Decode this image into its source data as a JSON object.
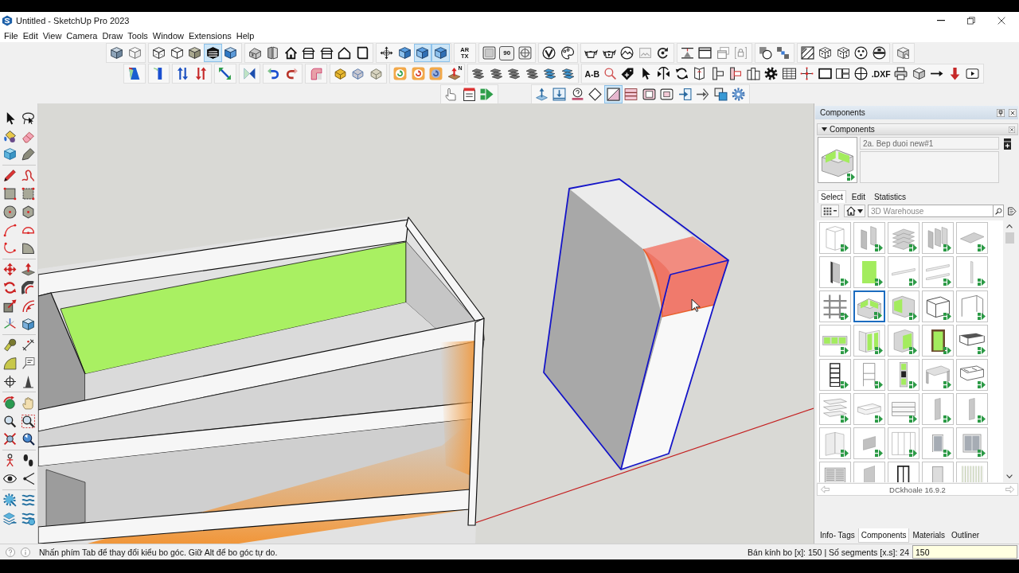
{
  "window": {
    "title": "Untitled - SketchUp Pro 2023"
  },
  "menu": [
    "File",
    "Edit",
    "View",
    "Camera",
    "Draw",
    "Tools",
    "Window",
    "Extensions",
    "Help"
  ],
  "toolbars": [
    {
      "groups": [
        {
          "buttons": [
            {
              "kind": "cube-xray",
              "selected": false
            },
            {
              "kind": "cube-edges",
              "selected": false
            }
          ]
        },
        {
          "buttons": [
            {
              "kind": "cube-wireframe",
              "selected": false
            },
            {
              "kind": "cube-hidden-line",
              "selected": false
            },
            {
              "kind": "cube-shaded",
              "selected": false
            },
            {
              "kind": "cube-striped",
              "selected": true
            },
            {
              "kind": "cube-textured",
              "selected": false
            }
          ]
        },
        {
          "buttons": [
            {
              "kind": "house-iso",
              "selected": false
            },
            {
              "kind": "door-pair",
              "selected": false
            },
            {
              "kind": "house",
              "selected": false
            },
            {
              "kind": "house-roof",
              "selected": false
            },
            {
              "kind": "house-roof",
              "selected": false
            },
            {
              "kind": "house-outline",
              "selected": false
            },
            {
              "kind": "page",
              "selected": false
            }
          ]
        },
        {
          "buttons": [
            {
              "kind": "axes-arrows",
              "selected": false
            },
            {
              "kind": "cube-section",
              "selected": false
            },
            {
              "kind": "cube-section",
              "selected": true
            },
            {
              "kind": "cube-section",
              "selected": true
            }
          ]
        },
        {
          "buttons": [
            {
              "kind": "text-stacked",
              "label": "AR TX",
              "selected": false
            }
          ]
        },
        {
          "buttons": [
            {
              "kind": "frame",
              "selected": false
            },
            {
              "kind": "text-framed",
              "label": "90",
              "selected": false
            },
            {
              "kind": "target",
              "selected": false
            }
          ]
        },
        {
          "buttons": [
            {
              "kind": "v-circle",
              "selected": false
            },
            {
              "kind": "palette",
              "selected": false
            }
          ]
        },
        {
          "buttons": [
            {
              "kind": "teapot",
              "selected": false
            },
            {
              "kind": "teapot-play",
              "selected": false
            },
            {
              "kind": "mountain-circle",
              "selected": false
            },
            {
              "kind": "picture-frame",
              "selected": false
            },
            {
              "kind": "refresh-partial",
              "selected": false
            }
          ]
        },
        {
          "buttons": [
            {
              "kind": "lamp-frame",
              "selected": false
            },
            {
              "kind": "window-frame",
              "selected": false
            },
            {
              "kind": "windows-stack",
              "selected": false
            },
            {
              "kind": "lock-frame",
              "selected": false
            }
          ]
        },
        {
          "buttons": [
            {
              "kind": "overlap-circles",
              "selected": false
            },
            {
              "kind": "dots-scatter",
              "selected": false
            }
          ]
        },
        {
          "buttons": [
            {
              "kind": "map-tile",
              "selected": false
            },
            {
              "kind": "dice",
              "selected": false
            },
            {
              "kind": "dice",
              "selected": false
            },
            {
              "kind": "dots-ball",
              "selected": false
            },
            {
              "kind": "split-ball",
              "selected": false
            }
          ]
        },
        {
          "buttons": [
            {
              "kind": "cube-hand",
              "selected": false
            }
          ]
        }
      ]
    },
    {
      "groups": [
        {
          "buttons": [
            {
              "kind": "paint-square",
              "selected": false
            }
          ]
        },
        {
          "buttons": [
            {
              "kind": "bar-vertical",
              "selected": false
            }
          ]
        },
        {
          "buttons": [
            {
              "kind": "arrows-up-down",
              "selected": false
            },
            {
              "kind": "arrows-down-up",
              "selected": false
            }
          ]
        },
        {
          "buttons": [
            {
              "kind": "diagonal-arrow",
              "selected": false
            }
          ]
        },
        {
          "buttons": [
            {
              "kind": "hourglass",
              "selected": false
            }
          ]
        },
        {
          "buttons": [
            {
              "kind": "curved-arrow",
              "selected": false
            },
            {
              "kind": "curved-arrow-back",
              "selected": false
            }
          ]
        },
        {
          "buttons": [
            {
              "kind": "pipe-elbow",
              "selected": false
            }
          ]
        },
        {
          "buttons": [
            {
              "kind": "round-block",
              "selected": false
            },
            {
              "kind": "round-block-plain",
              "selected": false
            },
            {
              "kind": "round-block-soft",
              "selected": false
            }
          ]
        },
        {
          "buttons": [
            {
              "kind": "ring-arrow",
              "selected": false
            },
            {
              "kind": "ring-arrow-back",
              "selected": false
            },
            {
              "kind": "ring-arrow-dim",
              "selected": false
            },
            {
              "kind": "box-arrow-up",
              "label": "N",
              "selected": false
            }
          ]
        },
        {
          "buttons": [
            {
              "kind": "tile-stack",
              "selected": false
            },
            {
              "kind": "tile-stack",
              "selected": false
            },
            {
              "kind": "tile-stack",
              "selected": false
            },
            {
              "kind": "tile-stack",
              "selected": false
            },
            {
              "kind": "tile-stack-tinted",
              "selected": false
            },
            {
              "kind": "tile-stack-tinted",
              "selected": false
            }
          ]
        },
        {
          "buttons": [
            {
              "kind": "text",
              "label": "A-B",
              "selected": false
            },
            {
              "kind": "magnifier",
              "selected": false
            },
            {
              "kind": "tag-plus",
              "selected": false
            },
            {
              "kind": "pointer",
              "selected": false
            },
            {
              "kind": "flip-arrows",
              "selected": false
            },
            {
              "kind": "refresh",
              "selected": false
            },
            {
              "kind": "book-open",
              "selected": false
            },
            {
              "kind": "align-block",
              "selected": false
            },
            {
              "kind": "align-block-marked",
              "selected": false
            },
            {
              "kind": "columns",
              "selected": false
            },
            {
              "kind": "gear",
              "selected": false
            },
            {
              "kind": "table",
              "selected": false
            },
            {
              "kind": "crosshair-dots",
              "selected": false
            },
            {
              "kind": "rectangle",
              "selected": false
            },
            {
              "kind": "panels-grid",
              "selected": false
            },
            {
              "kind": "circle-cross",
              "selected": false
            },
            {
              "kind": "text",
              "label": ".DXF",
              "selected": false
            },
            {
              "kind": "printer",
              "selected": false
            },
            {
              "kind": "box-open",
              "selected": false
            },
            {
              "kind": "arrow-right",
              "selected": false
            },
            {
              "kind": "arrow-down",
              "selected": false
            },
            {
              "kind": "play-square",
              "selected": false
            }
          ]
        }
      ]
    },
    {
      "groups": [
        {
          "buttons": [
            {
              "kind": "hand-pointer",
              "selected": false
            },
            {
              "kind": "clipboard",
              "selected": false
            },
            {
              "kind": "play-blocks",
              "selected": false
            }
          ]
        },
        {
          "buttons": [
            {
              "kind": "pin-up",
              "selected": false
            },
            {
              "kind": "download-tray",
              "selected": false
            },
            {
              "kind": "question-stamp",
              "selected": false
            },
            {
              "kind": "diamond-plus",
              "selected": false
            },
            {
              "kind": "square-diagonal",
              "selected": true
            },
            {
              "kind": "stripes-box",
              "selected": false
            },
            {
              "kind": "frame-rounded",
              "selected": false
            },
            {
              "kind": "frame-rounded-small",
              "selected": false
            },
            {
              "kind": "arrow-into-box",
              "selected": false
            },
            {
              "kind": "arrow-into-bracket",
              "selected": false
            },
            {
              "kind": "squares-overlap",
              "selected": false
            },
            {
              "kind": "gear-badge",
              "selected": false
            }
          ]
        }
      ]
    }
  ],
  "left_toolbar": {
    "groups": [
      {
        "buttons": [
          {
            "kind": "select-arrow",
            "selected": false
          },
          {
            "kind": "lasso",
            "selected": false
          },
          {
            "kind": "paint-bucket",
            "selected": false
          },
          {
            "kind": "eraser",
            "selected": false
          },
          {
            "kind": "cube-tinted",
            "selected": false
          },
          {
            "kind": "pen-tag",
            "selected": false
          }
        ]
      },
      {
        "buttons": [
          {
            "kind": "pencil",
            "selected": false
          },
          {
            "kind": "freehand",
            "selected": false
          },
          {
            "kind": "rectangle-tool",
            "selected": false
          },
          {
            "kind": "rectangle-rotated",
            "selected": false
          },
          {
            "kind": "circle-tool",
            "selected": false
          },
          {
            "kind": "polygon-tool",
            "selected": false
          },
          {
            "kind": "arc",
            "selected": false
          },
          {
            "kind": "arc-center",
            "selected": false
          },
          {
            "kind": "arc-three",
            "selected": false
          },
          {
            "kind": "pie",
            "selected": false
          }
        ]
      },
      {
        "buttons": [
          {
            "kind": "move-arrows",
            "selected": false
          },
          {
            "kind": "push-pull",
            "selected": false
          },
          {
            "kind": "rotate-arrows",
            "selected": false
          },
          {
            "kind": "follow-me",
            "selected": false
          },
          {
            "kind": "scale-box",
            "selected": false
          },
          {
            "kind": "offset",
            "selected": false
          },
          {
            "kind": "axes",
            "selected": false
          },
          {
            "kind": "texture-cube",
            "selected": false
          }
        ]
      },
      {
        "buttons": [
          {
            "kind": "tape-measure",
            "selected": false
          },
          {
            "kind": "dimension",
            "selected": false
          },
          {
            "kind": "protractor",
            "selected": false
          },
          {
            "kind": "text-box",
            "selected": false
          },
          {
            "kind": "axes-target",
            "selected": false
          },
          {
            "kind": "section-plane",
            "selected": false
          }
        ]
      },
      {
        "buttons": [
          {
            "kind": "orbit",
            "selected": false
          },
          {
            "kind": "hand",
            "selected": false
          },
          {
            "kind": "zoom",
            "selected": false
          },
          {
            "kind": "zoom-window",
            "selected": false
          },
          {
            "kind": "zoom-extents",
            "selected": false
          },
          {
            "kind": "zoom-previous",
            "selected": false
          }
        ]
      },
      {
        "buttons": [
          {
            "kind": "person",
            "selected": false
          },
          {
            "kind": "footprints",
            "selected": false
          },
          {
            "kind": "eye",
            "selected": false
          },
          {
            "kind": "look-around",
            "selected": false
          }
        ]
      },
      {
        "buttons": [
          {
            "kind": "gear-box",
            "selected": false
          },
          {
            "kind": "waves",
            "selected": false
          },
          {
            "kind": "layers-arrow",
            "selected": false
          },
          {
            "kind": "waves-gear",
            "selected": false
          }
        ]
      }
    ]
  },
  "components_panel": {
    "title": "Components",
    "section_title": "Components",
    "component_name": "2a. Bep duoi new#1",
    "tabs": [
      {
        "label": "Select",
        "selected": true
      },
      {
        "label": "Edit",
        "selected": false
      },
      {
        "label": "Statistics",
        "selected": false
      }
    ],
    "search": {
      "placeholder": "3D Warehouse"
    },
    "items": [
      {
        "kind": "frame",
        "selected": false
      },
      {
        "kind": "panels",
        "selected": false
      },
      {
        "kind": "shelves",
        "selected": false
      },
      {
        "kind": "panels-three",
        "selected": false
      },
      {
        "kind": "board",
        "selected": false
      },
      {
        "kind": "panel-edge",
        "selected": false
      },
      {
        "kind": "panel-filled",
        "selected": false
      },
      {
        "kind": "rail",
        "selected": false
      },
      {
        "kind": "rails",
        "selected": false
      },
      {
        "kind": "post",
        "selected": false
      },
      {
        "kind": "grid",
        "selected": false
      },
      {
        "kind": "cabinet",
        "selected": true
      },
      {
        "kind": "cabinet-side",
        "selected": false
      },
      {
        "kind": "cabinet-open",
        "selected": false
      },
      {
        "kind": "frame-open",
        "selected": false
      },
      {
        "kind": "cabinet-row",
        "selected": false
      },
      {
        "kind": "corner-cabinet",
        "selected": false
      },
      {
        "kind": "wall-cabinet",
        "selected": false
      },
      {
        "kind": "wardrobe",
        "selected": false
      },
      {
        "kind": "drawer-unit",
        "selected": false
      },
      {
        "kind": "shelf-tower",
        "selected": false
      },
      {
        "kind": "tall-frame",
        "selected": false
      },
      {
        "kind": "oven-tower",
        "selected": false
      },
      {
        "kind": "desk",
        "selected": false
      },
      {
        "kind": "drawer-frame",
        "selected": false
      },
      {
        "kind": "drawers",
        "selected": false
      },
      {
        "kind": "drawer",
        "selected": false
      },
      {
        "kind": "drawers-flat",
        "selected": false
      },
      {
        "kind": "panel",
        "selected": false
      },
      {
        "kind": "panel",
        "selected": false
      },
      {
        "kind": "door-panels",
        "selected": false
      },
      {
        "kind": "panel-tilted",
        "selected": false
      },
      {
        "kind": "doors-frame",
        "selected": false
      },
      {
        "kind": "window",
        "selected": false
      },
      {
        "kind": "window-double",
        "selected": false
      },
      {
        "kind": "louver-doors",
        "selected": false
      },
      {
        "kind": "panel-tall",
        "selected": false
      },
      {
        "kind": "door-frame",
        "selected": false
      },
      {
        "kind": "door",
        "selected": false
      },
      {
        "kind": "curtain",
        "selected": false
      }
    ],
    "collection": "DCkhoale 16.9.2"
  },
  "tray_tabs": [
    {
      "label": "Info- Tags",
      "selected": false
    },
    {
      "label": "Components",
      "selected": true
    },
    {
      "label": "Materials",
      "selected": false
    },
    {
      "label": "Outliner",
      "selected": false
    }
  ],
  "status_bar": {
    "message": "Nhấn phím Tab để thay đổi kiểu bo góc. Giữ Alt để bo góc tự do.",
    "measurement_label": "Bán kính bo [x]: 150 | Số segments [x.s]: 24",
    "measurement_value": "150"
  }
}
